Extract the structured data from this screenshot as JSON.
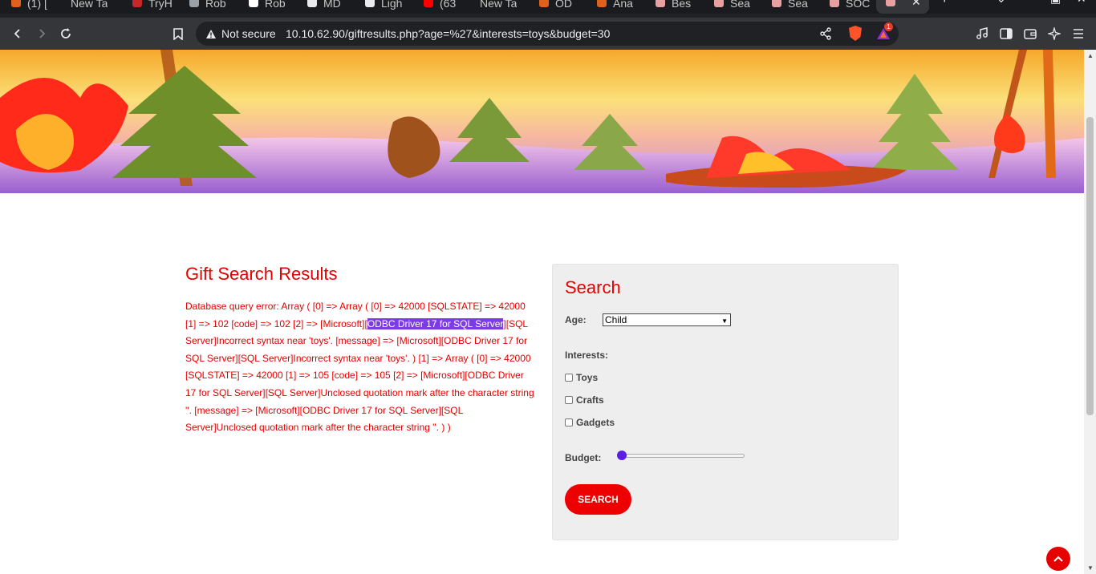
{
  "browser": {
    "tabs": [
      {
        "label": "(1) [",
        "color": "#e0611b"
      },
      {
        "label": "New Ta",
        "color": "#5f6368"
      },
      {
        "label": "TryH",
        "color": "#c62828"
      },
      {
        "label": "Rob",
        "color": "#9aa0a6"
      },
      {
        "label": "Rob",
        "color": "#ffffff"
      },
      {
        "label": "MD",
        "color": "#e8eaed"
      },
      {
        "label": "Ligh",
        "color": "#e8eaed"
      },
      {
        "label": "(63",
        "color": "#ff0000"
      },
      {
        "label": "New Ta",
        "color": "#5f6368"
      },
      {
        "label": "OD",
        "color": "#e0611b"
      },
      {
        "label": "Ana",
        "color": "#e0611b"
      },
      {
        "label": "Bes",
        "color": "#e8a0a0"
      },
      {
        "label": "Sea",
        "color": "#e8a0a0"
      },
      {
        "label": "Sea",
        "color": "#e8a0a0"
      },
      {
        "label": "SOC",
        "color": "#e8a0a0"
      }
    ],
    "not_secure_label": "Not secure",
    "url": "10.10.62.90/giftresults.php?age=%27&interests=toys&budget=30",
    "notification_count": "1"
  },
  "results": {
    "title": "Gift Search Results",
    "error_before": "Database query error: Array ( [0] => Array ( [0] => 42000 [SQLSTATE] => 42000 [1] => 102 [code] => 102 [2] => [Microsoft][",
    "error_highlight": "ODBC Driver 17 for SQL Server",
    "error_after": "][SQL Server]Incorrect syntax near 'toys'. [message] => [Microsoft][ODBC Driver 17 for SQL Server][SQL Server]Incorrect syntax near 'toys'. ) [1] => Array ( [0] => 42000 [SQLSTATE] => 42000 [1] => 105 [code] => 105 [2] => [Microsoft][ODBC Driver 17 for SQL Server][SQL Server]Unclosed quotation mark after the character string ''. [message] => [Microsoft][ODBC Driver 17 for SQL Server][SQL Server]Unclosed quotation mark after the character string ''. ) )"
  },
  "search": {
    "title": "Search",
    "age_label": "Age:",
    "age_value": "Child",
    "interests_label": "Interests:",
    "interests": [
      "Toys",
      "Crafts",
      "Gadgets"
    ],
    "budget_label": "Budget:",
    "budget_value": 0,
    "button_label": "SEARCH"
  },
  "colors": {
    "accent": "#e60000",
    "slider": "#5b1de6",
    "highlight": "#7b3ce8"
  }
}
